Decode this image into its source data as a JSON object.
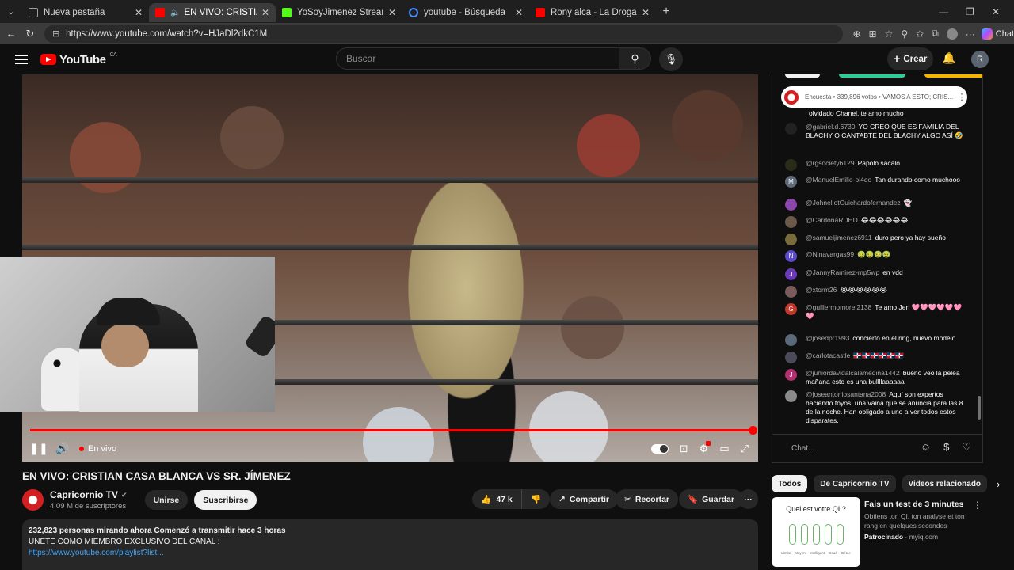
{
  "browser": {
    "tabs": [
      {
        "title": "Nueva pestaña",
        "icon": "page-icon",
        "color": "#9aa0a6"
      },
      {
        "title": "EN VIVO: CRISTIAN CASA BLA",
        "icon": "youtube-icon",
        "color": "#ff0000"
      },
      {
        "title": "YoSoyJimenez Stream - Watch Live",
        "icon": "kick-icon",
        "color": "#53fc18"
      },
      {
        "title": "youtube - Búsqueda",
        "icon": "search-icon",
        "color": "#4f8cff"
      },
      {
        "title": "Rony alca - La Droga e Mala ( Vide",
        "icon": "youtube-icon",
        "color": "#ff0000"
      }
    ],
    "url": "https://www.youtube.com/watch?v=HJaDl2dkC1M",
    "chat_label": "Chat"
  },
  "yt": {
    "logo": "YouTube",
    "country": "CA",
    "search_placeholder": "Buscar",
    "create_label": "Crear",
    "avatar_letter": "R"
  },
  "player": {
    "live_label": "En vivo",
    "progress": 1.0
  },
  "video": {
    "title": "EN VIVO: CRISTIAN CASA BLANCA VS SR. JÍMENEZ",
    "channel": "Capricornio TV",
    "subscribers": "4.09 M de suscriptores",
    "join_label": "Unirse",
    "subscribe_label": "Suscribirse",
    "likes": "47 k",
    "share_label": "Compartir",
    "clip_label": "Recortar",
    "save_label": "Guardar"
  },
  "description": {
    "stats": "232,823 personas mirando ahora  Comenzó a transmitir hace 3 horas",
    "line2": "UNETE COMO MIEMBRO EXCLUSIVO DEL CANAL :",
    "link": "https://www.youtube.com/playlist?list..."
  },
  "chat": {
    "poll": "Encuesta • 339,896 votos • VAMOS A ESTO; CRIS...",
    "input_placeholder": "Chat...",
    "messages": [
      {
        "user": "",
        "text": "olvidado Chanel, te amo mucho",
        "color": "#444",
        "letter": ""
      },
      {
        "user": "@gabriel.d.6730",
        "text": "YO CREO QUE ES FAMILIA DEL BLACHY O CANTABTE DEL BLACHY ALGO ASÍ 🤣",
        "color": "#222",
        "letter": ""
      },
      {
        "user": "@rgsociety6129",
        "text": "Papolo sacalo",
        "color": "#2b2b1a",
        "letter": ""
      },
      {
        "user": "@ManuelEmilio-ol4qo",
        "text": "Tan durando como muchooo",
        "color": "#5f6a7a",
        "letter": "M"
      },
      {
        "user": "@JohnellotGuichardofernandez",
        "text": "👻",
        "color": "#8e44ad",
        "letter": "I"
      },
      {
        "user": "@CardonaRDHD",
        "text": "😂😂😂😂😂😂",
        "color": "#6b5a4a",
        "letter": ""
      },
      {
        "user": "@samueljimenez6911",
        "text": "duro pero ya hay sueño",
        "color": "#7a6b3a",
        "letter": ""
      },
      {
        "user": "@Ninavargas99",
        "text": "🤢🤢🤢🤢",
        "color": "#5c4bc9",
        "letter": "N"
      },
      {
        "user": "@JannyRamirez-mp5wp",
        "text": "en vdd",
        "color": "#6a3ab8",
        "letter": "J"
      },
      {
        "user": "@xtorm26",
        "text": "😭😭😭😭😭😭",
        "color": "#7a5a5a",
        "letter": ""
      },
      {
        "user": "@guillermomorel2138",
        "text": "Te amo Jeri 🩷🩷🩷🩷🩷🩷🩷",
        "color": "#c0392b",
        "letter": "G"
      },
      {
        "user": "@josedpr1993",
        "text": "concierto en el ring, nuevo modelo",
        "color": "#5a6a7a",
        "letter": ""
      },
      {
        "user": "@carlotacastle",
        "text": "🇩🇴🇩🇴🇩🇴🇩🇴🇩🇴🇩🇴",
        "color": "#4a4a5a",
        "letter": ""
      },
      {
        "user": "@juniordavidalcalamedina1442",
        "text": "bueno veo la pelea mañana esto es una bullllaaaaaa",
        "color": "#b03070",
        "letter": "J"
      },
      {
        "user": "@joseantoniosantana2008",
        "text": "Aquí son expertos haciendo toyos, una vaina que se anuncia para las 8 de la noche. Han obligado a uno a ver todos estos disparates.",
        "color": "#8a8a8a",
        "letter": ""
      }
    ]
  },
  "related": {
    "chips": [
      "Todos",
      "De Capricornio TV",
      "Videos relacionado"
    ],
    "ad": {
      "thumb_title": "Quel est votre QI ?",
      "thumb_labels": [
        "Limite",
        "Moyen",
        "Intelligent",
        "Doué",
        "Génie"
      ],
      "title": "Fais un test de 3 minutes",
      "desc": "Obtiens ton QI, ton analyse et ton rang en quelques secondes",
      "sponsor": "Patrocinado",
      "domain": "myiq.com"
    }
  },
  "colors": {
    "accent": "#ff0000",
    "bg": "#0f0f0f",
    "link": "#3ea6ff"
  }
}
